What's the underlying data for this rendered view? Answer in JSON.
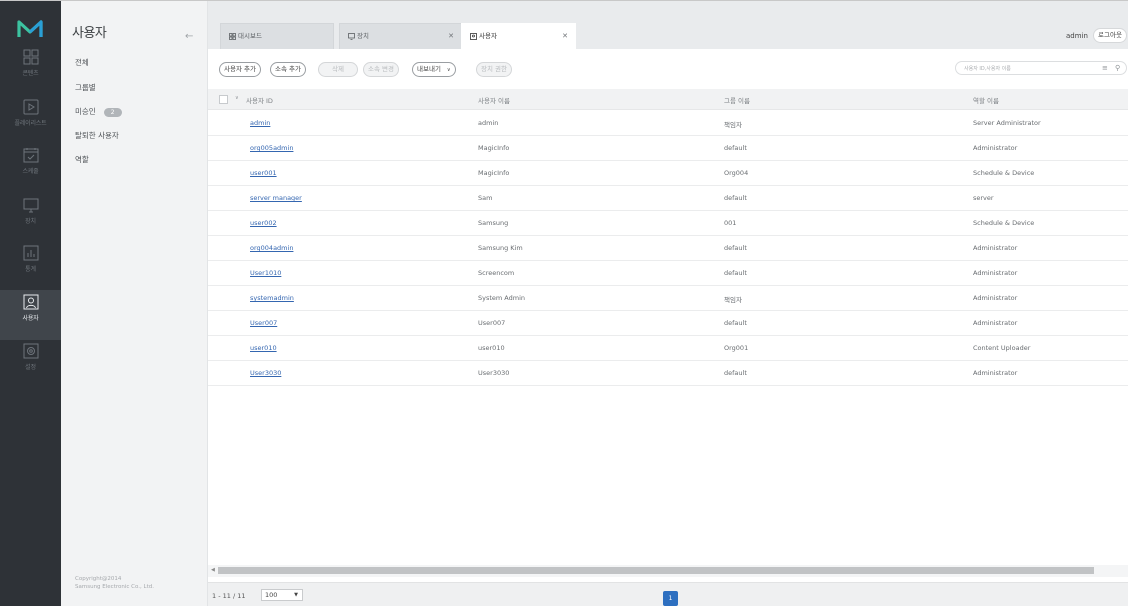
{
  "nav": {
    "items": [
      {
        "id": "content",
        "label": "콘텐츠",
        "icon": "content-grid-icon"
      },
      {
        "id": "playlist",
        "label": "플레이리스트",
        "icon": "playlist-icon"
      },
      {
        "id": "schedule",
        "label": "스케줄",
        "icon": "schedule-calendar-icon"
      },
      {
        "id": "device",
        "label": "장치",
        "icon": "device-monitor-icon"
      },
      {
        "id": "statistics",
        "label": "통계",
        "icon": "statistics-chart-icon"
      },
      {
        "id": "user",
        "label": "사용자",
        "icon": "user-icon"
      },
      {
        "id": "settings",
        "label": "설정",
        "icon": "settings-gear-icon"
      }
    ],
    "active": "user"
  },
  "submenu": {
    "title": "사용자",
    "items": [
      "전체",
      "그룹별",
      "미승인",
      "탈퇴한 사용자",
      "역할"
    ],
    "unapproved_count": "2",
    "copyright_line1": "Copyright@2014",
    "copyright_line2": "Samsung Electronic Co., Ltd."
  },
  "tabs": [
    {
      "label": "대시보드",
      "icon": "dashboard-icon",
      "closable": false
    },
    {
      "label": "장치",
      "icon": "device-icon",
      "closable": true
    },
    {
      "label": "사용자",
      "icon": "user-tab-icon",
      "closable": true,
      "active": true
    }
  ],
  "header": {
    "username": "admin",
    "logout_label": "로그아웃"
  },
  "toolbar": {
    "add_user": "사용자 추가",
    "add_affiliation": "소속 추가",
    "delete": "삭제",
    "change_affiliation": "소속 변경",
    "export": "내보내기",
    "change_permission": "장치 권한",
    "search_placeholder": "사용자 ID,사용자 이름"
  },
  "table": {
    "columns": [
      "사용자 ID",
      "사용자 이름",
      "그룹 이름",
      "역할 이름"
    ],
    "rows": [
      [
        "admin",
        "admin",
        "책임자",
        "Server Administrator"
      ],
      [
        "org005admin",
        "MagicInfo",
        "default",
        "Administrator"
      ],
      [
        "user001",
        "MagicInfo",
        "Org004",
        "Schedule & Device"
      ],
      [
        "server manager",
        "Sam",
        "default",
        "server"
      ],
      [
        "user002",
        "Samsung",
        "001",
        "Schedule & Device"
      ],
      [
        "org004admin",
        "Samsung Kim",
        "default",
        "Administrator"
      ],
      [
        "User1010",
        "Screencom",
        "default",
        "Administrator"
      ],
      [
        "systemadmin",
        "System Admin",
        "책임자",
        "Administrator"
      ],
      [
        "User007",
        "User007",
        "default",
        "Administrator"
      ],
      [
        "user010",
        "user010",
        "Org001",
        "Content Uploader"
      ],
      [
        "User3030",
        "User3030",
        "default",
        "Administrator"
      ]
    ]
  },
  "footer": {
    "page_info": "1 - 11 / 11",
    "page_size": "100",
    "current_page": "1"
  },
  "colors": {
    "nav_bg": "#2e3237",
    "accent": "#2d6fc0",
    "link": "#3466b0"
  }
}
